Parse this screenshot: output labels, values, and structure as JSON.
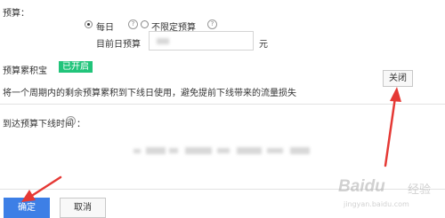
{
  "budget": {
    "label": "预算：",
    "options": [
      {
        "label": "每日",
        "selected": true
      },
      {
        "label": "不限定预算",
        "selected": false
      }
    ],
    "daily_budget_label": "目前日预算",
    "unit": "元"
  },
  "budget_accumulation": {
    "label": "预算累积宝",
    "status_badge": "已开启",
    "description": "将一个周期内的剩余预算累积到下线日使用，避免提前下线带来的流量损失",
    "close_button": "关闭"
  },
  "offline_time": {
    "label": "到达预算下线时间",
    "colon": "："
  },
  "footer": {
    "confirm_button": "确定",
    "cancel_button": "取消"
  },
  "watermark": {
    "brand": "Baidu",
    "site": "经验",
    "url": "jingyan.baidu.com"
  },
  "colors": {
    "primary": "#3d7fe6",
    "badge_green": "#21c47a",
    "arrow_red": "#e53935"
  }
}
